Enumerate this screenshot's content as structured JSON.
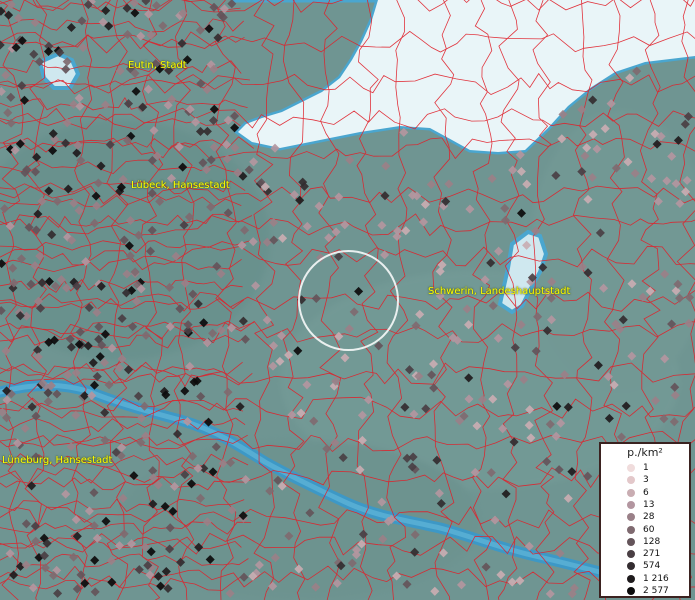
{
  "map": {
    "colors": {
      "land": "#6f9592",
      "sea": "#e4f2f6",
      "water_edge": "#4aa6cf",
      "boundary": "#e0202a",
      "label": "#ffff00",
      "legend_border": "#3b2220"
    },
    "places": [
      {
        "name": "Eutin, Stadt"
      },
      {
        "name": "Lübeck, Hansestadt"
      },
      {
        "name": "Schwerin, Landeshauptstadt"
      },
      {
        "name": "Lüneburg, Hansestadt"
      }
    ]
  },
  "legend": {
    "title": "p./km²",
    "items": [
      {
        "label": "1",
        "color": "#f0dcdc"
      },
      {
        "label": "3",
        "color": "#e3c8ca"
      },
      {
        "label": "6",
        "color": "#c9adb2"
      },
      {
        "label": "13",
        "color": "#b396a0"
      },
      {
        "label": "28",
        "color": "#9a8088"
      },
      {
        "label": "60",
        "color": "#7f6a70"
      },
      {
        "label": "128",
        "color": "#64545a"
      },
      {
        "label": "271",
        "color": "#4a3f44"
      },
      {
        "label": "574",
        "color": "#332c30"
      },
      {
        "label": "1 216",
        "color": "#1f1b1d"
      },
      {
        "label": "2 577",
        "color": "#0c0b0c"
      }
    ]
  }
}
